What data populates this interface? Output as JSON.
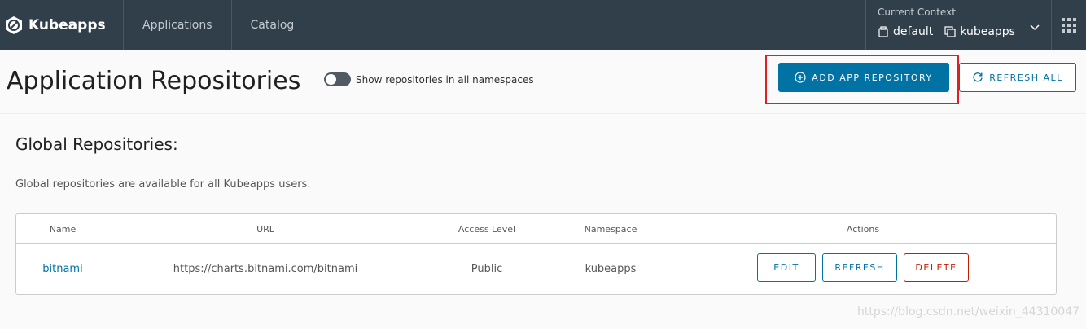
{
  "header": {
    "brand": "Kubeapps",
    "nav": [
      "Applications",
      "Catalog"
    ],
    "context_label": "Current Context",
    "cluster": "default",
    "namespace": "kubeapps"
  },
  "page": {
    "title": "Application Repositories",
    "toggle_label": "Show repositories in all namespaces",
    "toggle_on": false,
    "add_button": "ADD APP REPOSITORY",
    "refresh_all_button": "REFRESH ALL"
  },
  "section": {
    "title": "Global Repositories:",
    "description": "Global repositories are available for all Kubeapps users."
  },
  "table": {
    "columns": [
      "Name",
      "URL",
      "Access Level",
      "Namespace",
      "Actions"
    ],
    "rows": [
      {
        "name": "bitnami",
        "url": "https://charts.bitnami.com/bitnami",
        "access": "Public",
        "namespace": "kubeapps",
        "actions": [
          "EDIT",
          "REFRESH",
          "DELETE"
        ]
      }
    ]
  },
  "watermark": "https://blog.csdn.net/weixin_44310047",
  "colors": {
    "topbar": "#313f4b",
    "primary": "#0072a3",
    "danger": "#c21d00",
    "highlight": "#e02020"
  }
}
